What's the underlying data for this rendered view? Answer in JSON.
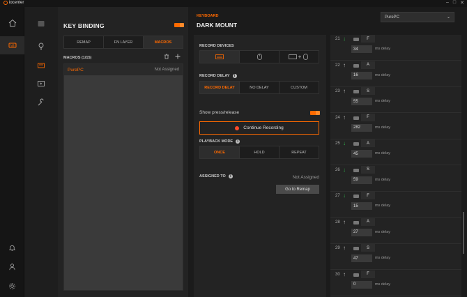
{
  "app": {
    "logo_text": "iocenter"
  },
  "left": {
    "title": "KEY BINDING",
    "tabs": [
      "REMAP",
      "FN LAYER",
      "MACROS"
    ],
    "active_tab": "MACROS",
    "macros_label": "MACROS (1/15)",
    "macros": [
      {
        "name": "PurePC",
        "status": "Not Assigned"
      }
    ]
  },
  "center": {
    "category": "KEYBOARD",
    "device": "DARK MOUNT",
    "record_devices_label": "RECORD DEVICES",
    "record_delay_label": "RECORD DELAY",
    "delay_options": [
      "RECORD DELAY",
      "NO DELAY",
      "CUSTOM"
    ],
    "show_press_label": "Show press/release",
    "record_button": "Continue Recording",
    "playback_label": "PLAYBACK MODE",
    "playback_options": [
      "ONCE",
      "HOLD",
      "REPEAT"
    ],
    "assigned_label": "ASSIGNED TO",
    "assigned_value": "Not Assigned",
    "remap_button": "Go to Remap"
  },
  "right": {
    "profile": "PurePC",
    "delay_unit": "ms delay",
    "steps": [
      {
        "num": "21",
        "dir": "down",
        "key": "F",
        "delay": "34"
      },
      {
        "num": "22",
        "dir": "up",
        "key": "A",
        "delay": "16"
      },
      {
        "num": "23",
        "dir": "up",
        "key": "S",
        "delay": "55"
      },
      {
        "num": "24",
        "dir": "up",
        "key": "F",
        "delay": "282"
      },
      {
        "num": "25",
        "dir": "down",
        "key": "A",
        "delay": "45"
      },
      {
        "num": "26",
        "dir": "down",
        "key": "S",
        "delay": "59"
      },
      {
        "num": "27",
        "dir": "down",
        "key": "F",
        "delay": "15"
      },
      {
        "num": "28",
        "dir": "up",
        "key": "A",
        "delay": "27"
      },
      {
        "num": "29",
        "dir": "up",
        "key": "S",
        "delay": "47"
      },
      {
        "num": "30",
        "dir": "up",
        "key": "F",
        "delay": "0"
      }
    ]
  },
  "colors": {
    "accent": "#ff6a00",
    "down_arrow": "#2fb04a"
  }
}
